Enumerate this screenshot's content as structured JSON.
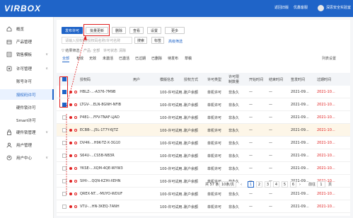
{
  "header": {
    "logo": "VIRBOX",
    "nav": [
      "返回旧版",
      "优鑫客服",
      "深思安全实验室"
    ]
  },
  "sidebar": {
    "items": [
      {
        "label": "概览",
        "icon": "home-icon"
      },
      {
        "label": "产品管理",
        "icon": "box-icon"
      },
      {
        "label": "销售模板",
        "icon": "template-icon",
        "arrow": "∨"
      },
      {
        "label": "许可管理",
        "icon": "license-icon",
        "arrow": "∧"
      },
      {
        "label": "硬件锁管理",
        "icon": "lock-icon",
        "arrow": "∨"
      },
      {
        "label": "用户管理",
        "icon": "user-icon"
      },
      {
        "label": "用户中心",
        "icon": "user-center-icon",
        "arrow": "∨"
      }
    ],
    "subitems": [
      "账号许可",
      "授权码许可",
      "硬件锁许可",
      "Smart许可"
    ]
  },
  "toolbar": {
    "issue": "发布许可",
    "batch_update": "批量更新",
    "delete": "删除",
    "view": "查看",
    "settings": "设置",
    "more": "更多"
  },
  "search": {
    "placeholder": "请输入授权码/授权码名称/许可名称",
    "search_btn": "搜索",
    "tag_btn": "标签",
    "advanced": "高级筛选"
  },
  "filter": {
    "label": "▽ 结果筛选:",
    "tag1": "产品: 全部",
    "tag2": "许可状态",
    "tag3": "清除"
  },
  "tabs": {
    "items": [
      "全部",
      "有效",
      "无效",
      "未激活",
      "已激活",
      "已过期",
      "已删除",
      "待发布",
      "草稿"
    ],
    "settings": "列表设置"
  },
  "table": {
    "headers": [
      "授权码",
      "用户",
      "模版信息",
      "授权方式",
      "许可类型",
      "许可限制数量",
      "开始时间",
      "结束时间",
      "签发时间",
      "过期时间"
    ],
    "rows": [
      {
        "code": "HBLZ-...-A376-7M9B",
        "template": "100-许可试用...",
        "method": "账户余额",
        "type": "单机许可",
        "limit": "非永久",
        "start": "—",
        "end": "—",
        "issued": "2021-09...",
        "expire": "2021-10...",
        "checked": true
      },
      {
        "code": "LTGV-...ELN-8GNH-NFIB",
        "template": "100-许可试用...",
        "method": "账户余额",
        "type": "单机许可",
        "limit": "非永久",
        "start": "—",
        "end": "—",
        "issued": "2021-09...",
        "expire": "2021-10...",
        "checked": true
      },
      {
        "code": "P481-...FPV-TNAF-LJAD",
        "template": "100-许可试用...",
        "method": "账户余额",
        "type": "单机许可",
        "limit": "非永久",
        "start": "—",
        "end": "—",
        "issued": "2021-09...",
        "expire": "2021-10...",
        "checked": false
      },
      {
        "code": "ECBB-...J5L-1T7Y-6JTZ",
        "template": "100-许可试用...",
        "method": "账户余额",
        "type": "单机许可",
        "limit": "非永久",
        "start": "—",
        "end": "—",
        "issued": "2021-09...",
        "expire": "2021-10...",
        "checked": false
      },
      {
        "code": "DV4K-...H9K-TZ-X-3G10",
        "template": "100-许可试用...",
        "method": "账户余额",
        "type": "单机许可",
        "limit": "非永久",
        "start": "—",
        "end": "—",
        "issued": "2021-09...",
        "expire": "2021-10...",
        "checked": false
      },
      {
        "code": "S64U-...CS5B-NB3R",
        "template": "100-许可试用...",
        "method": "账户余额",
        "type": "单机许可",
        "limit": "非永久",
        "start": "—",
        "end": "—",
        "issued": "2021-09...",
        "expire": "2021-10...",
        "checked": false
      },
      {
        "code": "YKSE-...XQM-4QE-WYW3",
        "template": "100-许可试用...",
        "method": "账户余额",
        "type": "单机许可",
        "limit": "非永久",
        "start": "—",
        "end": "—",
        "issued": "2021-09...",
        "expire": "2021-10...",
        "checked": false
      },
      {
        "code": "SIHI-...QQN-KZHI-XEHN",
        "template": "100-许可试用...",
        "method": "账户余额",
        "type": "单机许可",
        "limit": "非永久",
        "start": "—",
        "end": "—",
        "issued": "2021-09...",
        "expire": "2021-10...",
        "checked": false
      },
      {
        "code": "QREX-NT...-MUYO-WDUF",
        "template": "100-许可试用...",
        "method": "账户余额",
        "type": "单机许可",
        "limit": "非永久",
        "start": "—",
        "end": "—",
        "issued": "2021-09...",
        "expire": "2021-10...",
        "checked": false
      },
      {
        "code": "VTU-...HN-3KEQ-7ANH",
        "template": "100-许可试用...",
        "method": "账户余额",
        "type": "单机许可",
        "limit": "非永久",
        "start": "—",
        "end": "—",
        "issued": "2021-09...",
        "expire": "2021-10...",
        "checked": false
      }
    ]
  },
  "pagination": {
    "total": "共 57 条",
    "size": "10条/页",
    "pages": [
      "1",
      "2",
      "3",
      "4",
      "5",
      "6"
    ],
    "goto": "前往",
    "goto_value": "1",
    "page_unit": "页"
  },
  "colors": {
    "brand": "#1f64c8",
    "highlight": "#e02020",
    "expire": "#e02020"
  }
}
